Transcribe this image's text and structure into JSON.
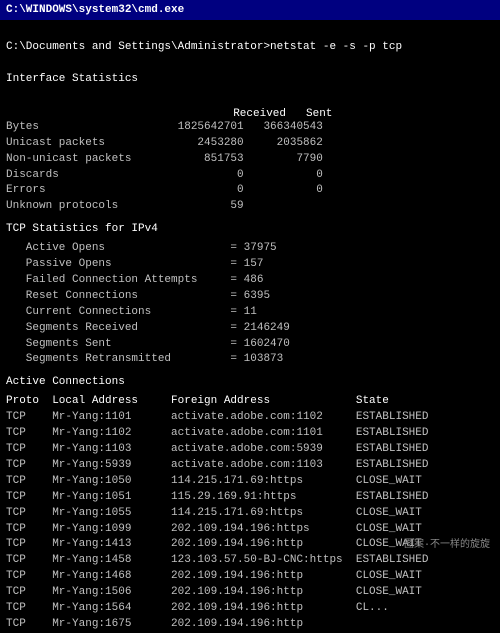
{
  "titleBar": {
    "label": "C:\\WINDOWS\\system32\\cmd.exe"
  },
  "prompt": "C:\\Documents and Settings\\Administrator>netstat -e -s -p tcp",
  "interfaceStats": {
    "header": "Interface Statistics",
    "columns": [
      "",
      "Received",
      "Sent"
    ],
    "rows": [
      [
        "Bytes",
        "1825642701",
        "366340543"
      ],
      [
        "Unicast packets",
        "2453280",
        "2035862"
      ],
      [
        "Non-unicast packets",
        "851753",
        "7790"
      ],
      [
        "Discards",
        "0",
        "0"
      ],
      [
        "Errors",
        "0",
        "0"
      ],
      [
        "Unknown protocols",
        "59",
        ""
      ]
    ]
  },
  "tcpStats": {
    "header": "TCP Statistics for IPv4",
    "rows": [
      [
        "Active Opens",
        "37975"
      ],
      [
        "Passive Opens",
        "157"
      ],
      [
        "Failed Connection Attempts",
        "486"
      ],
      [
        "Reset Connections",
        "6395"
      ],
      [
        "Current Connections",
        "11"
      ],
      [
        "Segments Received",
        "2146249"
      ],
      [
        "Segments Sent",
        "1602470"
      ],
      [
        "Segments Retransmitted",
        "103873"
      ]
    ]
  },
  "activeConnections": {
    "header": "Active Connections",
    "columns": [
      "Proto",
      "Local Address",
      "Foreign Address",
      "State"
    ],
    "rows": [
      [
        "TCP",
        "Mr-Yang:1101",
        "activate.adobe.com:1102",
        "ESTABLISHED"
      ],
      [
        "TCP",
        "Mr-Yang:1102",
        "activate.adobe.com:1101",
        "ESTABLISHED"
      ],
      [
        "TCP",
        "Mr-Yang:1103",
        "activate.adobe.com:5939",
        "ESTABLISHED"
      ],
      [
        "TCP",
        "Mr-Yang:5939",
        "activate.adobe.com:1103",
        "ESTABLISHED"
      ],
      [
        "TCP",
        "Mr-Yang:1050",
        "114.215.171.69:https",
        "CLOSE_WAIT"
      ],
      [
        "TCP",
        "Mr-Yang:1051",
        "115.29.169.91:https",
        "ESTABLISHED"
      ],
      [
        "TCP",
        "Mr-Yang:1055",
        "114.215.171.69:https",
        "CLOSE_WAIT"
      ],
      [
        "TCP",
        "Mr-Yang:1099",
        "202.109.194.196:https",
        "CLOSE_WAIT"
      ],
      [
        "TCP",
        "Mr-Yang:1413",
        "202.109.194.196:http",
        "CLOSE_WAIT"
      ],
      [
        "TCP",
        "Mr-Yang:1458",
        "123.103.57.50-BJ-CNC:https",
        "ESTABLISHED"
      ],
      [
        "TCP",
        "Mr-Yang:1468",
        "202.109.194.196:http",
        "CLOSE_WAIT"
      ],
      [
        "TCP",
        "Mr-Yang:1506",
        "202.109.194.196:http",
        "CLOSE_WAIT"
      ],
      [
        "TCP",
        "Mr-Yang:1564",
        "202.109.194.196:http",
        "CL..."
      ],
      [
        "TCP",
        "Mr-Yang:1675",
        "202.109.194.196:http",
        ""
      ]
    ]
  },
  "watermark": "图案·不一样的旋旋"
}
